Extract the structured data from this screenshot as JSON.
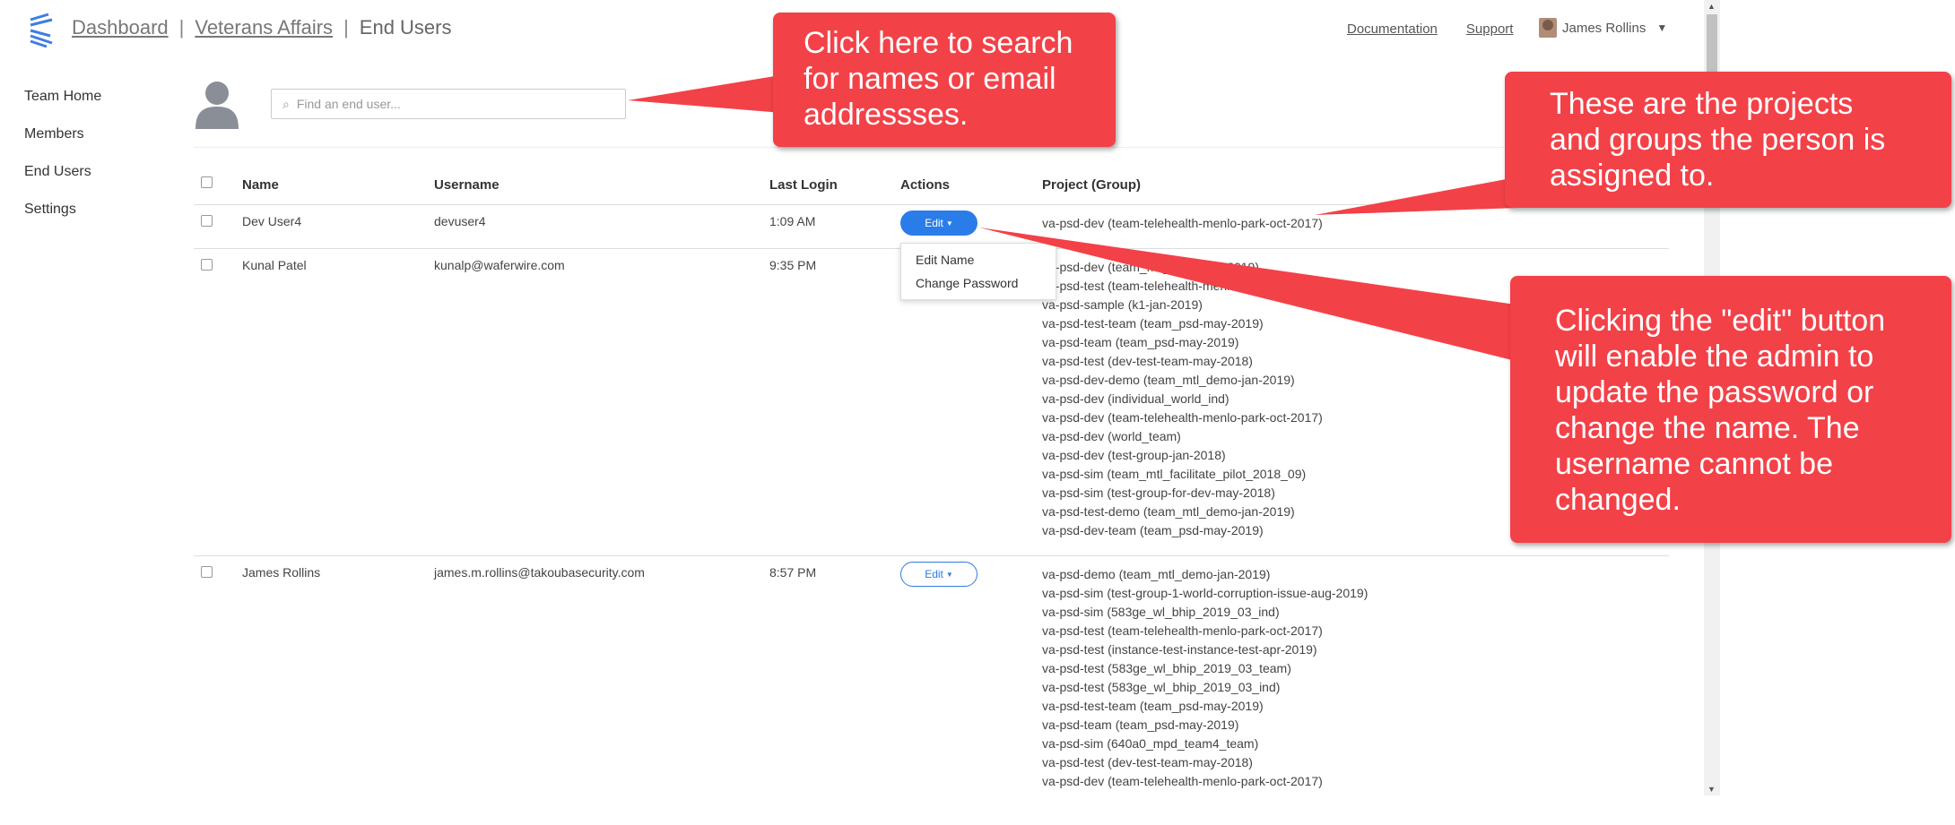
{
  "header": {
    "breadcrumbs": [
      "Dashboard",
      "Veterans Affairs"
    ],
    "current": "End Users",
    "links": [
      "Documentation",
      "Support"
    ],
    "user_name": "James Rollins"
  },
  "sidebar": {
    "items": [
      {
        "label": "Team Home"
      },
      {
        "label": "Members"
      },
      {
        "label": "End Users"
      },
      {
        "label": "Settings"
      }
    ]
  },
  "search": {
    "placeholder": "Find an end user..."
  },
  "table": {
    "columns": [
      "Name",
      "Username",
      "Last Login",
      "Actions",
      "Project (Group)"
    ],
    "edit_label": "Edit",
    "rows": [
      {
        "name": "Dev User4",
        "username": "devuser4",
        "last_login": "1:09 AM",
        "projects": [
          "va-psd-dev (team-telehealth-menlo-park-oct-2017)"
        ]
      },
      {
        "name": "Kunal Patel",
        "username": "kunalp@waferwire.com",
        "last_login": "9:35 PM",
        "projects": [
          "va-psd-dev (team_mtl_demo-jan-2019)",
          "va-psd-test (team-telehealth-menlo-park-oct-2017)",
          "va-psd-sample (k1-jan-2019)",
          "va-psd-test-team (team_psd-may-2019)",
          "va-psd-team (team_psd-may-2019)",
          "va-psd-test (dev-test-team-may-2018)",
          "va-psd-dev-demo (team_mtl_demo-jan-2019)",
          "va-psd-dev (individual_world_ind)",
          "va-psd-dev (team-telehealth-menlo-park-oct-2017)",
          "va-psd-dev (world_team)",
          "va-psd-dev (test-group-jan-2018)",
          "va-psd-sim (team_mtl_facilitate_pilot_2018_09)",
          "va-psd-sim (test-group-for-dev-may-2018)",
          "va-psd-test-demo (team_mtl_demo-jan-2019)",
          "va-psd-dev-team (team_psd-may-2019)"
        ]
      },
      {
        "name": "James Rollins",
        "username": "james.m.rollins@takoubasecurity.com",
        "last_login": "8:57 PM",
        "projects": [
          "va-psd-demo (team_mtl_demo-jan-2019)",
          "va-psd-sim (test-group-1-world-corruption-issue-aug-2019)",
          "va-psd-sim (583ge_wl_bhip_2019_03_ind)",
          "va-psd-test (team-telehealth-menlo-park-oct-2017)",
          "va-psd-test (instance-test-instance-test-apr-2019)",
          "va-psd-test (583ge_wl_bhip_2019_03_team)",
          "va-psd-test (583ge_wl_bhip_2019_03_ind)",
          "va-psd-test-team (team_psd-may-2019)",
          "va-psd-team (team_psd-may-2019)",
          "va-psd-sim (640a0_mpd_team4_team)",
          "va-psd-test (dev-test-team-may-2018)",
          "va-psd-dev (team-telehealth-menlo-park-oct-2017)"
        ]
      }
    ]
  },
  "edit_menu": {
    "items": [
      "Edit Name",
      "Change Password"
    ]
  },
  "callouts": {
    "search": [
      "Click here to search",
      "for names or email",
      "addressses."
    ],
    "projects": [
      "These are the projects",
      "and groups the person is",
      "assigned to."
    ],
    "edit": [
      "Clicking the \"edit\" button",
      "will enable the admin to",
      "update the password or",
      "change the name. The",
      "username cannot be",
      "changed."
    ]
  },
  "colors": {
    "callout": "#f34148",
    "accent": "#2a7de8"
  }
}
